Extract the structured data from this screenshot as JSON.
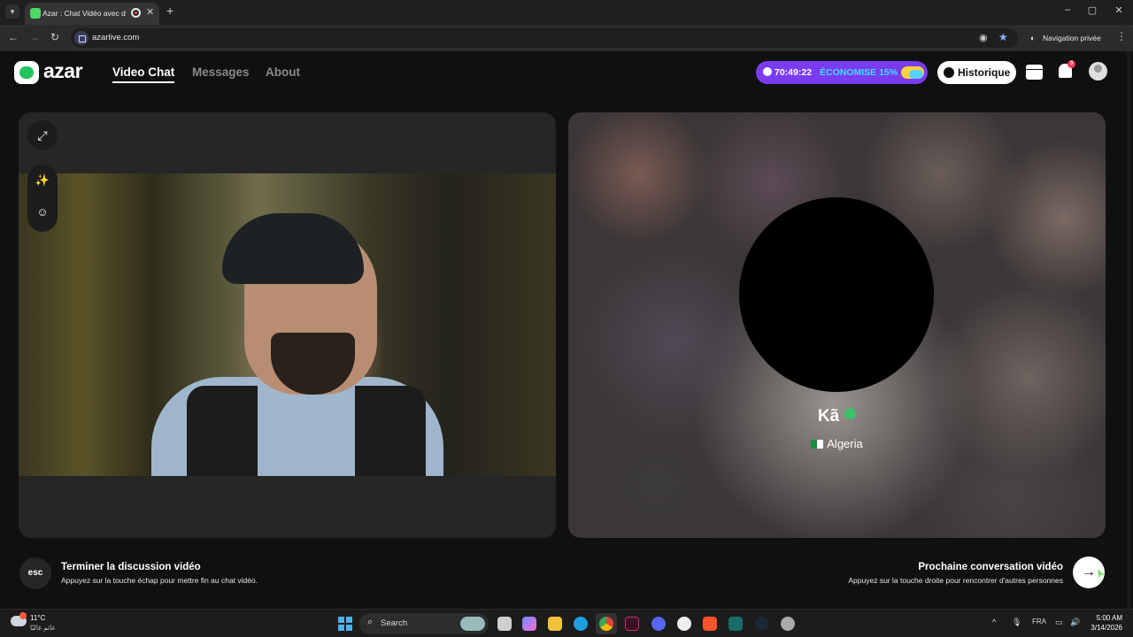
{
  "browser": {
    "tab_title": "Azar : Chat Vidéo avec de n",
    "tab_close": "✕",
    "new_tab": "+",
    "url": "azarlive.com",
    "private_label": "Navigation privée",
    "tab_list_icon": "▾",
    "window_controls": [
      "–",
      "▢",
      "✕"
    ]
  },
  "header": {
    "logo_text": "azar",
    "nav": [
      {
        "label": "Video Chat",
        "active": true
      },
      {
        "label": "Messages",
        "active": false
      },
      {
        "label": "About",
        "active": false
      }
    ],
    "promo_time": "70:49:22",
    "promo_save": "ÉCONOMISE 15%",
    "history_label": "Historique",
    "notification_count": "3"
  },
  "peer": {
    "name": "Kã",
    "country": "Algeria"
  },
  "hints": {
    "esc_label": "esc",
    "end_title": "Terminer la discussion vidéo",
    "end_sub": "Appuyez sur la touche échap pour mettre fin au chat vidéo.",
    "next_title": "Prochaine conversation vidéo",
    "next_sub": "Appuyez sur la touche droite pour rencontrer d'autres personnes",
    "next_arrow": "→"
  },
  "taskbar": {
    "temperature": "11°C",
    "weather_sub": "غائم غالبًا",
    "search_placeholder": "Search",
    "language": "FRA",
    "time": "5:00 AM",
    "date": "3/14/2026"
  },
  "colors": {
    "accent_green": "#21c45d",
    "promo_purple": "#7a3cf0",
    "promo_cyan": "#3ee0ff"
  }
}
